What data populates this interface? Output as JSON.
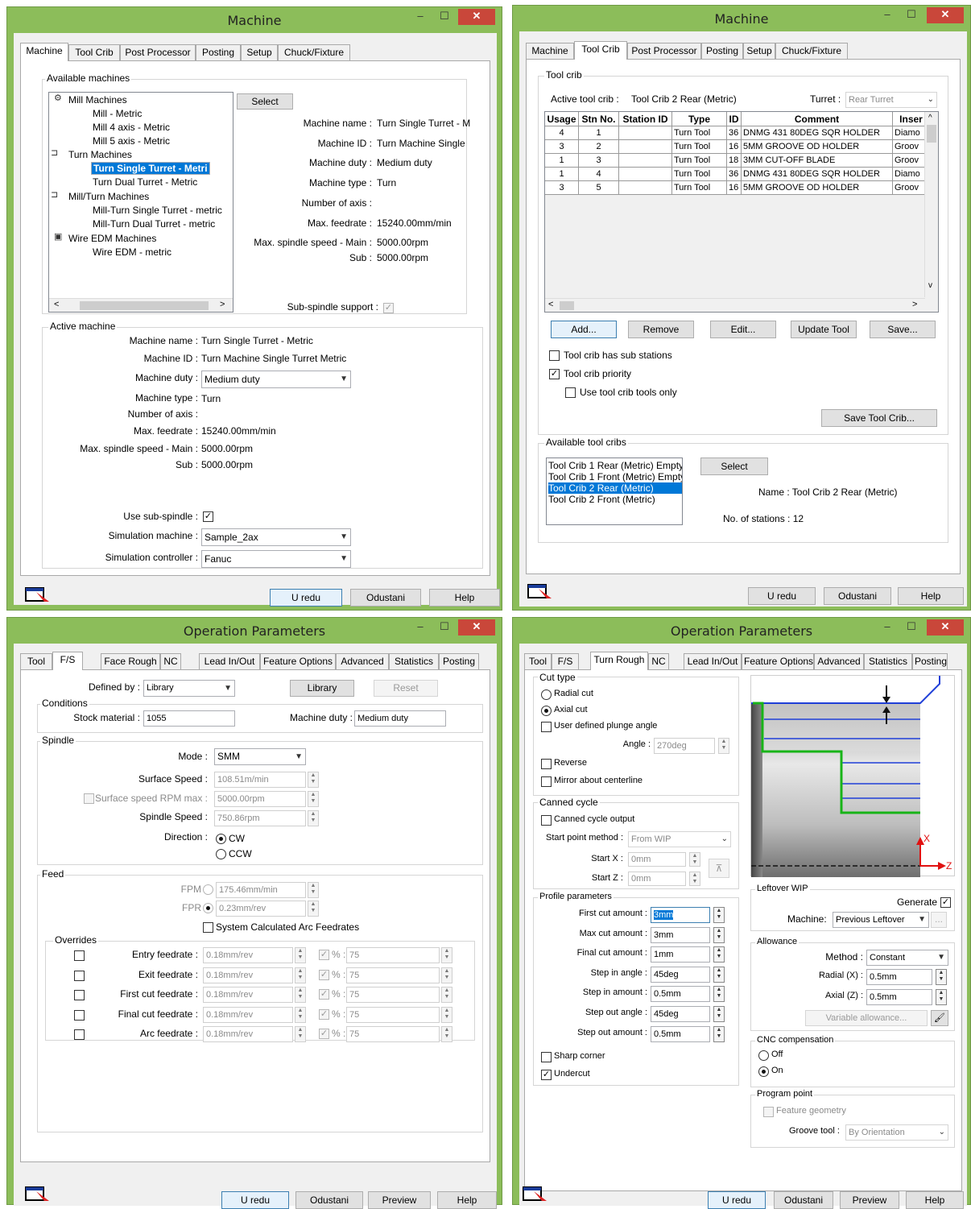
{
  "w1": {
    "title": "Machine",
    "tabs": [
      "Machine",
      "Tool Crib",
      "Post Processor",
      "Posting",
      "Setup",
      "Chuck/Fixture"
    ],
    "available": {
      "label": "Available machines",
      "tree": [
        "Mill Machines",
        "Mill - Metric",
        "Mill 4 axis - Metric",
        "Mill 5 axis - Metric",
        "Turn Machines",
        "Turn Single Turret - Metri",
        "Turn Dual Turret - Metric",
        "Mill/Turn Machines",
        "Mill-Turn Single Turret - metric",
        "Mill-Turn Dual Turret - metric",
        "Wire EDM Machines",
        "Wire EDM - metric"
      ],
      "select": "Select",
      "name_l": "Machine name :",
      "name_v": "Turn Single Turret - M",
      "id_l": "Machine ID :",
      "id_v": "Turn Machine Single",
      "duty_l": "Machine duty :",
      "duty_v": "Medium duty",
      "type_l": "Machine type :",
      "type_v": "Turn",
      "axis_l": "Number of axis :",
      "feed_l": "Max. feedrate :",
      "feed_v": "15240.00mm/min",
      "spm_l": "Max. spindle speed - Main :",
      "spm_v": "5000.00rpm",
      "sub_l": "Sub :",
      "sub_v": "5000.00rpm",
      "subsp_l": "Sub-spindle support :"
    },
    "active": {
      "label": "Active machine",
      "name_l": "Machine name :",
      "name_v": "Turn Single Turret - Metric",
      "id_l": "Machine ID :",
      "id_v": "Turn Machine Single Turret Metric",
      "duty_l": "Machine duty :",
      "duty_v": "Medium duty",
      "type_l": "Machine type :",
      "type_v": "Turn",
      "axis_l": "Number of axis :",
      "feed_l": "Max. feedrate :",
      "feed_v": "15240.00mm/min",
      "spm_l": "Max. spindle speed - Main :",
      "spm_v": "5000.00rpm",
      "sub_l": "Sub :",
      "sub_v": "5000.00rpm",
      "usesub_l": "Use sub-spindle :",
      "sim_l": "Simulation machine :",
      "sim_v": "Sample_2ax",
      "ctrl_l": "Simulation controller :",
      "ctrl_v": "Fanuc"
    },
    "ok": "U redu",
    "cancel": "Odustani",
    "help": "Help"
  },
  "w2": {
    "title": "Machine",
    "tabs": [
      "Machine",
      "Tool Crib",
      "Post Processor",
      "Posting",
      "Setup",
      "Chuck/Fixture"
    ],
    "grp": "Tool crib",
    "active_l": "Active tool crib :",
    "active_v": "Tool Crib 2 Rear (Metric)",
    "turret_l": "Turret :",
    "turret_v": "Rear Turret",
    "cols": [
      "Usage",
      "Stn No.",
      "Station ID",
      "Type",
      "ID",
      "Comment",
      "Inser"
    ],
    "rows": [
      [
        "4",
        "1",
        "",
        "Turn Tool",
        "36",
        "DNMG 431 80DEG SQR HOLDER",
        "Diamo"
      ],
      [
        "3",
        "2",
        "",
        "Turn Tool",
        "16",
        "5MM GROOVE OD HOLDER",
        "Groov"
      ],
      [
        "1",
        "3",
        "",
        "Turn Tool",
        "18",
        "3MM CUT-OFF BLADE",
        "Groov"
      ],
      [
        "1",
        "4",
        "",
        "Turn Tool",
        "36",
        "DNMG 431 80DEG SQR HOLDER",
        "Diamo"
      ],
      [
        "3",
        "5",
        "",
        "Turn Tool",
        "16",
        "5MM GROOVE OD HOLDER",
        "Groov"
      ]
    ],
    "add": "Add...",
    "remove": "Remove",
    "edit": "Edit...",
    "update": "Update Tool",
    "save": "Save...",
    "c1": "Tool crib has sub stations",
    "c2": "Tool crib priority",
    "c3": "Use tool crib tools only",
    "savecrib": "Save Tool Crib...",
    "avail": "Available tool cribs",
    "list": [
      "Tool Crib 1 Rear (Metric) Empty",
      "Tool Crib 1 Front (Metric) Empty",
      "Tool Crib 2 Rear (Metric)",
      "Tool Crib 2 Front (Metric)"
    ],
    "select": "Select",
    "name": "Name : Tool Crib 2 Rear (Metric)",
    "stations": "No. of stations : 12",
    "ok": "U redu",
    "cancel": "Odustani",
    "help": "Help"
  },
  "w3": {
    "title": "Operation Parameters",
    "tabs": [
      "Tool",
      "F/S",
      "Face Rough",
      "NC",
      "Lead In/Out",
      "Feature Options",
      "Advanced",
      "Statistics",
      "Posting"
    ],
    "defby_l": "Defined by :",
    "defby_v": "Library",
    "library": "Library",
    "reset": "Reset",
    "cond": "Conditions",
    "stock_l": "Stock material :",
    "stock_v": "1055",
    "duty_l": "Machine duty :",
    "duty_v": "Medium duty",
    "spindle": "Spindle",
    "mode_l": "Mode :",
    "mode_v": "SMM",
    "ss_l": "Surface Speed :",
    "ss_v": "108.51m/min",
    "ssmax_l": "Surface speed RPM max :",
    "ssmax_v": "5000.00rpm",
    "sp_l": "Spindle Speed :",
    "sp_v": "750.86rpm",
    "dir_l": "Direction :",
    "cw": "CW",
    "ccw": "CCW",
    "feed": "Feed",
    "fpm_l": "FPM",
    "fpm_v": "175.46mm/min",
    "fpr_l": "FPR",
    "fpr_v": "0.23mm/rev",
    "arc": "System Calculated Arc Feedrates",
    "ovr": "Overrides",
    "orows": [
      [
        "Entry feedrate :",
        "0.18mm/rev",
        "75"
      ],
      [
        "Exit feedrate :",
        "0.18mm/rev",
        "75"
      ],
      [
        "First cut feedrate :",
        "0.18mm/rev",
        "75"
      ],
      [
        "Final cut feedrate :",
        "0.18mm/rev",
        "75"
      ],
      [
        "Arc feedrate :",
        "0.18mm/rev",
        "75"
      ]
    ],
    "pct": "% :",
    "ok": "U redu",
    "cancel": "Odustani",
    "preview": "Preview",
    "help": "Help"
  },
  "w4": {
    "title": "Operation Parameters",
    "tabs": [
      "Tool",
      "F/S",
      "Turn Rough",
      "NC",
      "Lead In/Out",
      "Feature Options",
      "Advanced",
      "Statistics",
      "Posting"
    ],
    "cuttype": "Cut type",
    "radial": "Radial cut",
    "axial": "Axial cut",
    "udpa": "User defined plunge angle",
    "angle_l": "Angle :",
    "angle_v": "270deg",
    "reverse": "Reverse",
    "mirror": "Mirror about centerline",
    "canned": "Canned cycle",
    "cco": "Canned cycle output",
    "spm_l": "Start point method :",
    "spm_v": "From WIP",
    "sx_l": "Start X :",
    "sx_v": "0mm",
    "sz_l": "Start Z :",
    "sz_v": "0mm",
    "profile": "Profile parameters",
    "prows": [
      [
        "First cut amount :",
        "3mm"
      ],
      [
        "Max cut amount :",
        "3mm"
      ],
      [
        "Final cut amount :",
        "1mm"
      ],
      [
        "Step in angle :",
        "45deg"
      ],
      [
        "Step in amount :",
        "0.5mm"
      ],
      [
        "Step out angle :",
        "45deg"
      ],
      [
        "Step out amount :",
        "0.5mm"
      ]
    ],
    "sharp": "Sharp corner",
    "undercut": "Undercut",
    "leftover": "Leftover WIP",
    "generate": "Generate",
    "machine_l": "Machine:",
    "machine_v": "Previous Leftover",
    "allow": "Allowance",
    "method_l": "Method :",
    "method_v": "Constant",
    "radial_l": "Radial (X) :",
    "radial_v": "0.5mm",
    "axial_l": "Axial (Z) :",
    "axial_v": "0.5mm",
    "varallow": "Variable allowance...",
    "cnc": "CNC compensation",
    "off": "Off",
    "on": "On",
    "pp": "Program point",
    "featgeo": "Feature geometry",
    "groove_l": "Groove tool :",
    "groove_v": "By Orientation",
    "axis_x": "X",
    "axis_z": "Z",
    "ok": "U redu",
    "cancel": "Odustani",
    "preview": "Preview",
    "help": "Help"
  }
}
